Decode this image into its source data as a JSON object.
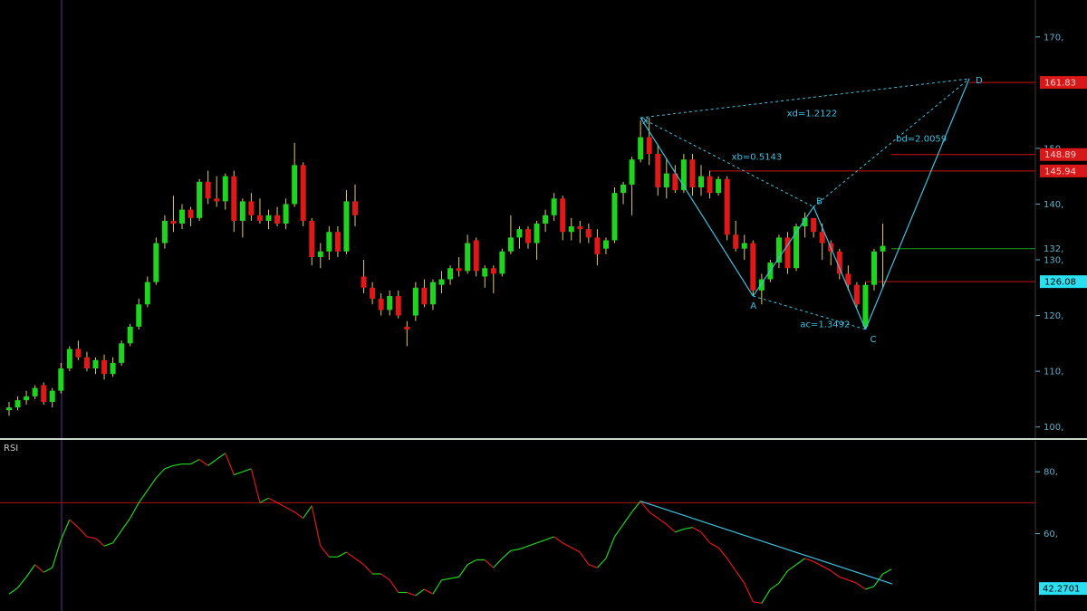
{
  "colors": {
    "background": "#000000",
    "up": "#1fd41f",
    "down": "#e01818",
    "pattern": "#3fc0e0",
    "level_red": "#d01010",
    "level_green": "#1aa01a",
    "axis_text": "#5fb0c8",
    "divider": "#c8d8c8"
  },
  "chart_data": [
    {
      "type": "candlestick",
      "name": "price",
      "ylim": [
        98,
        175
      ],
      "yticks": [
        {
          "v": 100,
          "label": "100,"
        },
        {
          "v": 110,
          "label": "110,"
        },
        {
          "v": 120,
          "label": "120,"
        },
        {
          "v": 130,
          "label": "130,"
        },
        {
          "v": 140,
          "label": "140,"
        },
        {
          "v": 150,
          "label": "150,"
        },
        {
          "v": 170,
          "label": "170,"
        }
      ],
      "candles": [
        [
          103.0,
          104.5,
          102.0,
          103.5
        ],
        [
          103.5,
          105.5,
          103.0,
          104.8
        ],
        [
          104.8,
          106.5,
          104.0,
          105.5
        ],
        [
          105.5,
          107.5,
          105.0,
          107.0
        ],
        [
          107.5,
          108.0,
          104.0,
          104.5
        ],
        [
          104.5,
          107.0,
          103.5,
          106.5
        ],
        [
          106.5,
          111.5,
          106.0,
          110.5
        ],
        [
          110.5,
          114.5,
          110.0,
          114.0
        ],
        [
          114.0,
          115.5,
          112.0,
          112.5
        ],
        [
          112.5,
          113.5,
          110.0,
          110.5
        ],
        [
          110.5,
          112.5,
          109.5,
          112.0
        ],
        [
          112.0,
          113.0,
          108.5,
          109.5
        ],
        [
          109.5,
          112.5,
          109.0,
          111.5
        ],
        [
          111.5,
          115.5,
          111.0,
          115.0
        ],
        [
          115.0,
          118.5,
          114.5,
          118.0
        ],
        [
          118.0,
          123.0,
          117.5,
          122.0
        ],
        [
          122.0,
          127.0,
          121.5,
          126.0
        ],
        [
          126.0,
          134.0,
          125.5,
          133.0
        ],
        [
          133.0,
          138.0,
          132.0,
          137.0
        ],
        [
          137.0,
          141.5,
          135.0,
          136.5
        ],
        [
          136.5,
          140.0,
          135.5,
          139.0
        ],
        [
          139.0,
          139.5,
          136.0,
          137.5
        ],
        [
          137.5,
          144.5,
          137.0,
          144.0
        ],
        [
          144.0,
          146.0,
          140.0,
          141.0
        ],
        [
          141.0,
          145.0,
          139.5,
          140.5
        ],
        [
          140.5,
          145.5,
          139.0,
          145.0
        ],
        [
          145.0,
          146.0,
          135.0,
          137.0
        ],
        [
          137.0,
          141.0,
          134.0,
          140.5
        ],
        [
          140.5,
          142.0,
          137.0,
          138.0
        ],
        [
          138.0,
          141.0,
          136.5,
          137.0
        ],
        [
          137.0,
          139.0,
          135.5,
          138.0
        ],
        [
          138.0,
          139.5,
          136.0,
          136.5
        ],
        [
          136.5,
          141.0,
          135.5,
          140.0
        ],
        [
          140.0,
          151.0,
          139.5,
          147.0
        ],
        [
          147.0,
          147.5,
          136.0,
          137.0
        ],
        [
          137.0,
          137.5,
          129.0,
          130.5
        ],
        [
          130.5,
          133.0,
          128.5,
          131.5
        ],
        [
          131.5,
          136.0,
          130.0,
          135.0
        ],
        [
          135.0,
          136.0,
          130.5,
          131.5
        ],
        [
          131.5,
          142.5,
          131.0,
          140.5
        ],
        [
          140.5,
          143.5,
          136.0,
          138.0
        ],
        [
          127.0,
          130.0,
          124.0,
          125.0
        ],
        [
          125.0,
          126.0,
          122.0,
          123.0
        ],
        [
          123.0,
          124.0,
          120.0,
          121.0
        ],
        [
          121.0,
          124.5,
          120.0,
          123.5
        ],
        [
          123.5,
          124.5,
          119.5,
          120.0
        ],
        [
          118.0,
          119.0,
          114.5,
          117.5
        ],
        [
          120.0,
          126.0,
          119.0,
          125.0
        ],
        [
          125.0,
          126.5,
          121.5,
          122.0
        ],
        [
          122.0,
          126.5,
          121.0,
          126.0
        ],
        [
          125.5,
          128.0,
          124.0,
          126.5
        ],
        [
          126.5,
          129.0,
          125.5,
          128.5
        ],
        [
          128.5,
          130.5,
          127.0,
          128.0
        ],
        [
          128.0,
          134.5,
          127.5,
          133.0
        ],
        [
          133.5,
          134.0,
          127.0,
          128.0
        ],
        [
          127.0,
          129.0,
          125.0,
          128.5
        ],
        [
          128.5,
          129.0,
          124.0,
          127.5
        ],
        [
          127.5,
          132.0,
          127.0,
          131.5
        ],
        [
          131.5,
          138.0,
          131.0,
          134.0
        ],
        [
          134.0,
          136.0,
          132.0,
          135.5
        ],
        [
          135.5,
          136.0,
          132.0,
          133.0
        ],
        [
          133.0,
          137.0,
          130.0,
          136.5
        ],
        [
          136.5,
          139.0,
          135.0,
          138.0
        ],
        [
          138.0,
          142.0,
          137.0,
          141.0
        ],
        [
          141.0,
          141.5,
          133.5,
          135.0
        ],
        [
          135.0,
          137.5,
          133.5,
          136.0
        ],
        [
          136.0,
          137.0,
          133.0,
          135.5
        ],
        [
          135.5,
          136.5,
          133.0,
          134.0
        ],
        [
          134.0,
          135.5,
          129.0,
          131.0
        ],
        [
          132.0,
          134.0,
          131.0,
          133.5
        ],
        [
          133.5,
          143.0,
          133.0,
          142.0
        ],
        [
          142.0,
          144.0,
          140.0,
          143.5
        ],
        [
          143.5,
          148.5,
          138.0,
          148.0
        ],
        [
          148.0,
          155.0,
          147.5,
          152.0
        ],
        [
          152.0,
          155.5,
          147.0,
          149.0
        ],
        [
          149.0,
          150.5,
          141.5,
          143.0
        ],
        [
          143.0,
          148.0,
          141.0,
          145.5
        ],
        [
          145.5,
          147.0,
          142.0,
          142.5
        ],
        [
          142.5,
          149.0,
          142.0,
          148.0
        ],
        [
          148.0,
          149.0,
          141.5,
          143.0
        ],
        [
          143.0,
          147.0,
          141.5,
          145.0
        ],
        [
          145.0,
          146.0,
          141.0,
          142.0
        ],
        [
          142.0,
          145.0,
          141.5,
          144.5
        ],
        [
          144.5,
          145.0,
          133.5,
          134.5
        ],
        [
          134.5,
          137.0,
          131.5,
          132.0
        ],
        [
          132.0,
          134.5,
          130.0,
          133.0
        ],
        [
          133.0,
          133.5,
          123.5,
          124.5
        ],
        [
          124.5,
          127.5,
          122.0,
          126.5
        ],
        [
          126.5,
          130.0,
          126.0,
          129.5
        ],
        [
          129.5,
          134.5,
          128.5,
          134.0
        ],
        [
          134.0,
          135.0,
          127.5,
          128.5
        ],
        [
          128.5,
          136.5,
          128.0,
          136.0
        ],
        [
          136.0,
          138.5,
          134.0,
          137.5
        ],
        [
          137.5,
          137.5,
          134.0,
          135.0
        ],
        [
          135.0,
          136.5,
          130.0,
          133.0
        ],
        [
          133.0,
          133.5,
          129.0,
          131.5
        ],
        [
          131.5,
          132.0,
          126.5,
          127.5
        ],
        [
          127.5,
          129.0,
          124.5,
          125.5
        ],
        [
          125.5,
          126.0,
          121.5,
          122.0
        ],
        [
          118.0,
          126.0,
          117.5,
          125.5
        ],
        [
          125.5,
          132.0,
          124.5,
          131.5
        ],
        [
          131.5,
          136.5,
          125.0,
          132.5
        ]
      ],
      "harmonic_pattern": {
        "points": [
          {
            "label": "X",
            "i": 73,
            "v": 155.5
          },
          {
            "label": "A",
            "i": 86,
            "v": 123.5
          },
          {
            "label": "B",
            "i": 93,
            "v": 139.5
          },
          {
            "label": "C",
            "i": 99,
            "v": 117.5
          },
          {
            "label": "D",
            "i": 111,
            "v": 162.5
          }
        ],
        "annotations": [
          {
            "text": "xd=1.2122",
            "between": [
              "X",
              "D"
            ]
          },
          {
            "text": "xb=0.5143",
            "between": [
              "X",
              "B"
            ]
          },
          {
            "text": "bd=2.0059",
            "between": [
              "B",
              "D"
            ]
          },
          {
            "text": "ac=1.3492",
            "between": [
              "A",
              "C"
            ]
          }
        ]
      },
      "levels": [
        {
          "value": 161.83,
          "label": "161.83",
          "color": "red",
          "start_i": 111
        },
        {
          "value": 148.89,
          "label": "148.89",
          "color": "red",
          "start_i": 102
        },
        {
          "value": 145.94,
          "label": "145.94",
          "color": "red",
          "start_i": 81
        },
        {
          "value": 132.0,
          "label": "132,",
          "color": "green",
          "start_i": 102
        },
        {
          "value": 126.08,
          "label": "126.08",
          "color": "cyan",
          "start_i": 99
        }
      ]
    },
    {
      "type": "line",
      "name": "RSI",
      "title": "RSI",
      "ylim": [
        35,
        90
      ],
      "yticks": [
        {
          "v": 60,
          "label": "60,"
        },
        {
          "v": 80,
          "label": "80,"
        }
      ],
      "overbought": 70,
      "current": {
        "value": 42.2701,
        "label": "42.2701"
      },
      "values": [
        40.5,
        42.5,
        46,
        50,
        47.5,
        49,
        58,
        64.5,
        62,
        59,
        58.5,
        56,
        57,
        61,
        65,
        70,
        74,
        78,
        81,
        82,
        82.5,
        82.5,
        84,
        82,
        84,
        86,
        79,
        80,
        81,
        70,
        71.5,
        70,
        68.5,
        67,
        65,
        69,
        56,
        52.5,
        52.5,
        54,
        52,
        50,
        47,
        47,
        45,
        41,
        41,
        40,
        42,
        40.5,
        45,
        45.5,
        46,
        50,
        51.5,
        51.5,
        49,
        52,
        54.5,
        55,
        56,
        57,
        58,
        59,
        57,
        55.5,
        54,
        50,
        49,
        52,
        59,
        63,
        67,
        70.5,
        67,
        65,
        63,
        60.5,
        61.5,
        62,
        60.5,
        57,
        55.5,
        52,
        48,
        44,
        38,
        37.5,
        42,
        44,
        48,
        50,
        52,
        51,
        49.5,
        48,
        46,
        45,
        44,
        42,
        43,
        47,
        48.5
      ],
      "trendline": {
        "start": {
          "i": 73,
          "v": 70.5
        },
        "end": {
          "i": 104,
          "v": 42.0
        }
      }
    }
  ]
}
